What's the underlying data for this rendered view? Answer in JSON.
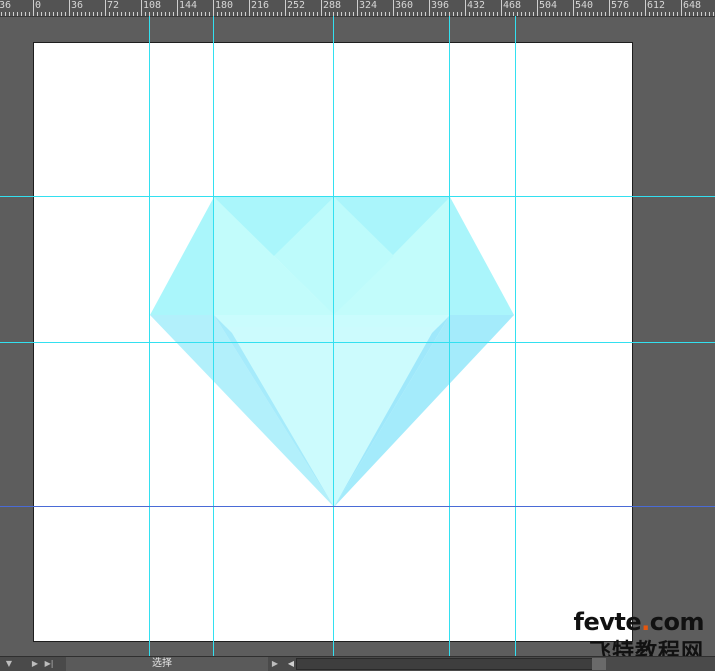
{
  "ruler": {
    "unit": "px",
    "labels": [
      "36",
      "0",
      "36",
      "72",
      "108",
      "144",
      "180",
      "216",
      "252",
      "288",
      "324",
      "360",
      "396",
      "432",
      "468",
      "504",
      "540",
      "576",
      "612",
      "648"
    ]
  },
  "artboard": {
    "background": "#ffffff"
  },
  "diamond": {
    "colors": {
      "crown_back": "#b7fbfc",
      "crown_side": "#a9f5fa",
      "crown_center": "#c6fcfb",
      "table": "#c8fdfa",
      "pavilion_center": "#cbfbfd",
      "pavilion_left": "#a8ecfb",
      "pavilion_right": "#9fe9fb"
    }
  },
  "guides": {
    "color": "#33e0f0",
    "alt_color": "#4a6bd6"
  },
  "watermark": {
    "domain_prefix": "fevte",
    "domain_dot": ".",
    "domain_suffix": "com",
    "chinese": "飞特教程网"
  },
  "statusbar": {
    "tool_label": "选择",
    "first_icon": "caret-down-icon",
    "nav_prev": "play-prev-icon",
    "nav_last": "play-last-icon",
    "play_right": "play-right-icon",
    "play_left": "play-left-icon"
  }
}
